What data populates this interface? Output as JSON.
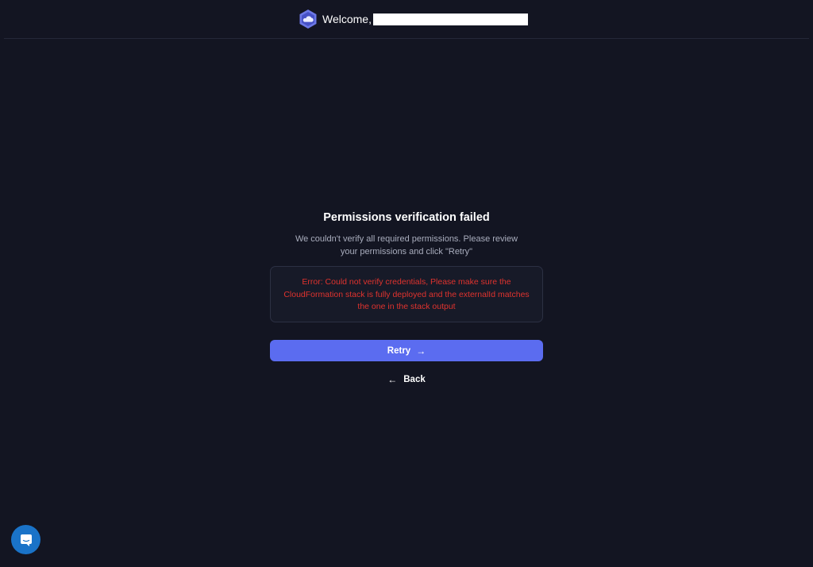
{
  "header": {
    "welcome_label": "Welcome,",
    "logo_icon": "cloud-hexagon-logo-icon",
    "redacted_name_color": "#ffffff"
  },
  "main": {
    "title": "Permissions verification failed",
    "subtitle": "We couldn't verify all required permissions. Please review your permissions and click \"Retry\"",
    "error_message": "Error: Could not verify credentials, Please make sure the CloudFormation stack is fully deployed and the externalId matches the one in the stack output",
    "retry_label": "Retry",
    "retry_icon": "arrow-right-icon",
    "back_label": "Back",
    "back_icon": "arrow-left-icon"
  },
  "chat_widget": {
    "icon": "chat-bubble-icon"
  },
  "colors": {
    "background": "#131522",
    "primary": "#5b6cf0",
    "error": "#e0332e",
    "chat": "#1a73c8"
  }
}
